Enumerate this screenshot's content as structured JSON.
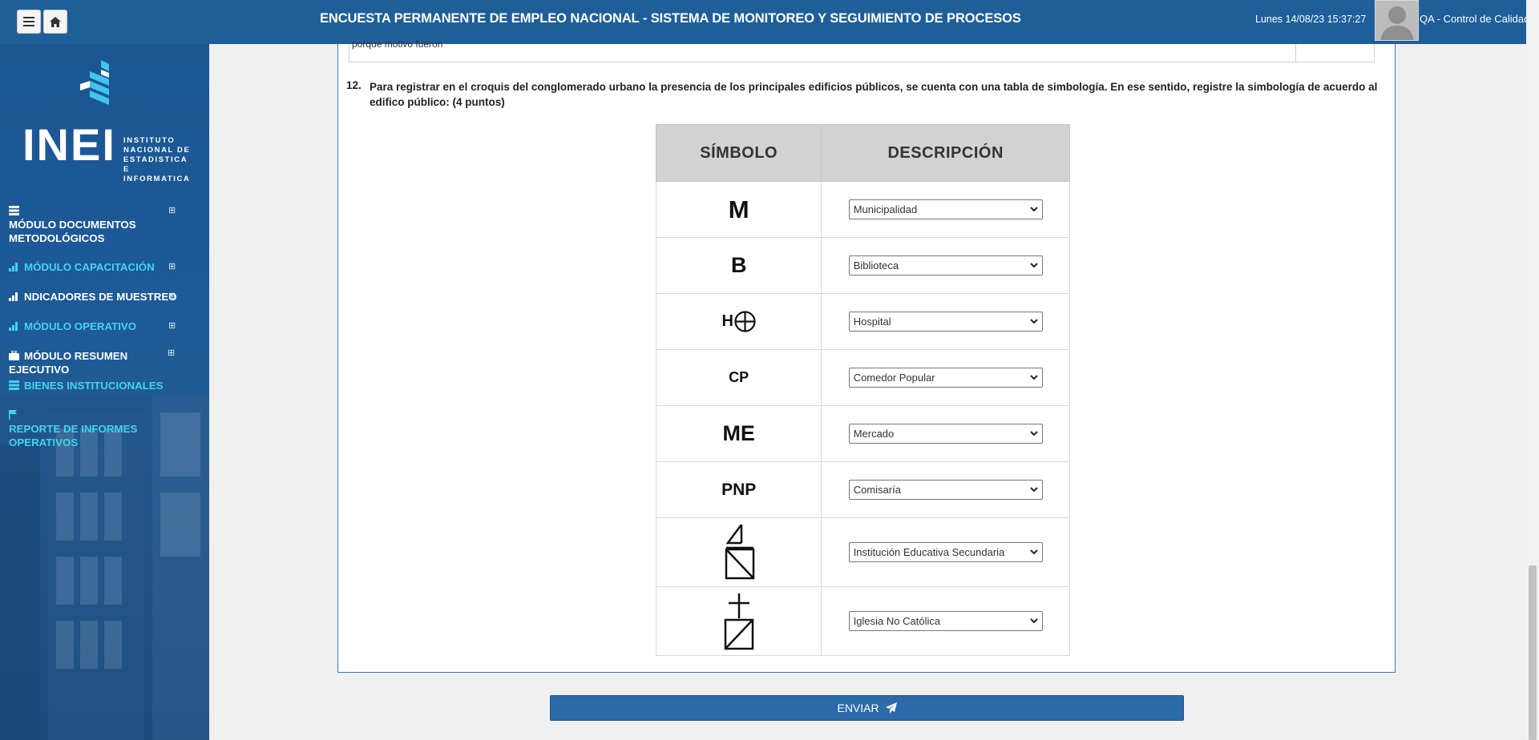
{
  "topbar": {
    "title": "ENCUESTA PERMANENTE DE EMPLEO NACIONAL - SISTEMA DE MONITOREO Y SEGUIMIENTO DE PROCESOS",
    "datetime": "Lunes 14/08/23 15:37:27",
    "user": "QA - Control de Calidad",
    "menu_icon": "hamburger-icon",
    "home_icon": "home-icon"
  },
  "sidebar": {
    "logo": {
      "main": "INEI",
      "sub": [
        "INSTITUTO",
        "NACIONAL DE",
        "ESTADISTICA E",
        "INFORMATICA"
      ]
    },
    "items": [
      {
        "label": "MÓDULO DOCUMENTOS METODOLÓGICOS",
        "icon": "database-icon",
        "color": "#ffffff",
        "expandable": true
      },
      {
        "label": "MÓDULO CAPACITACIÓN",
        "icon": "bar-chart-icon",
        "color": "#43d3f0",
        "expandable": true
      },
      {
        "label": "NDICADORES DE MUESTREO",
        "icon": "bar-chart-icon",
        "color": "#ffffff",
        "expandable": true
      },
      {
        "label": "MÓDULO OPERATIVO",
        "icon": "bar-chart-icon",
        "color": "#43d3f0",
        "expandable": true
      },
      {
        "label": "MÓDULO RESUMEN EJECUTIVO",
        "icon": "briefcase-icon",
        "color": "#ffffff",
        "expandable": true
      },
      {
        "label": "BIENES INSTITUCIONALES",
        "icon": "table-icon",
        "color": "#43d3f0",
        "expandable": false
      },
      {
        "label": "REPORTE DE INFORMES OPERATIVOS",
        "icon": "flag-icon",
        "color": "#43d3f0",
        "expandable": false
      }
    ],
    "expand_glyph": "⊞"
  },
  "question": {
    "number": "12.",
    "text": "Para registrar en el croquis del conglomerado urbano la presencia de los principales edificios públicos, se cuenta con una tabla de simbología. En ese sentido, registre la simbología de acuerdo al edifico público: (4 puntos)",
    "prev_cut_text": "porque motivo fueron"
  },
  "table": {
    "headers": [
      "SÍMBOLO",
      "DESCRIPCIÓN"
    ],
    "rows": [
      {
        "symbol": "M",
        "selected": "Municipalidad"
      },
      {
        "symbol": "B",
        "selected": "Biblioteca"
      },
      {
        "symbol": "H",
        "symbol_icon": "circle-cross-icon",
        "selected": "Hospital"
      },
      {
        "symbol": "CP",
        "selected": "Comedor Popular"
      },
      {
        "symbol": "ME",
        "selected": "Mercado"
      },
      {
        "symbol": "PNP",
        "selected": "Comisaría"
      },
      {
        "symbol_icon": "school-flag-icon",
        "selected": "Institución Educativa Secundaria"
      },
      {
        "symbol_icon": "church-cross-icon",
        "selected": "Iglesia No Católica"
      }
    ]
  },
  "submit": {
    "label": "ENVIAR",
    "icon": "paper-plane-icon"
  },
  "colors": {
    "topbar": "#1e5f9a",
    "sidebar": "#1b5693",
    "accent": "#43d3f0",
    "button": "#2c6aa9"
  }
}
